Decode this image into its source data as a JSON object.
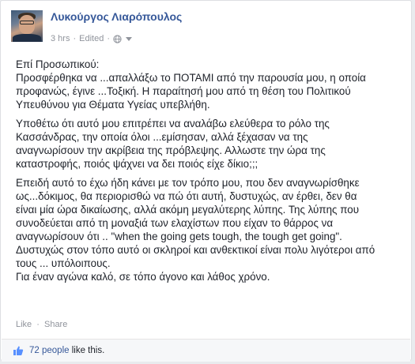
{
  "post": {
    "author": "Λυκούργος Λιαρόπουλος",
    "time": "3 hrs",
    "edited": "Edited",
    "paragraphs": [
      [
        "Επί Προσωπικού:",
        "Προσφέρθηκα να ...απαλλάξω το ΠΟΤΑΜΙ από την παρουσία μου, η οποία",
        "προφανώς, έγινε ...Τοξική. Η παραίτησή μου από τη θέση του Πολιτικού",
        "Υπευθύνου για Θέματα Υγείας υπεβλήθη."
      ],
      [
        "Υποθέτω ότι αυτό μου επιτρέπει να αναλάβω ελεύθερα το ρόλο της",
        "Κασσάνδρας, την οποία όλοι ...εμίσησαν, αλλά ξέχασαν να της",
        "αναγνωρίσουν την ακρίβεια της πρόβλεψης. Αλλωστε την ώρα της",
        "καταστροφής, ποιός ψάχνει να δει ποιός είχε δίκιο;;;"
      ],
      [
        "Επειδή αυτό το έχω ήδη κάνει με τον τρόπο μου, που δεν αναγνωρίσθηκε",
        "ως...δόκιμος, θα περιορισθώ να πώ ότι αυτή, δυστυχώς, αν έρθει, δεν θα",
        "είναι μία ώρα δικαίωσης, αλλά ακόμη μεγαλύτερης λύπης. Της λύπης που",
        "συνοδεύεται από τη μοναξιά των ελαχίστων που είχαν το θάρρος να",
        "αναγνωρίσουν ότι .. \"when the going gets tough, the tough get going\".",
        "Δυστυχώς στον τόπο αυτό οι σκληροί και ανθεκτικοί είναι πολυ λιγότεροι από",
        "τους ... υπόλοιπους.",
        "Για έναν αγώνα καλό, σε τόπο άγονο και λάθος χρόνο."
      ]
    ]
  },
  "actions": {
    "like": "Like",
    "share": "Share",
    "separator": "·"
  },
  "likes": {
    "count": "72 people",
    "suffix": "like this."
  },
  "icons": {
    "privacy": "globe-icon",
    "menu": "caret-down-icon",
    "like": "thumbs-up-icon"
  },
  "colors": {
    "link": "#365899",
    "meta": "#90949c",
    "text": "#1d2129"
  }
}
